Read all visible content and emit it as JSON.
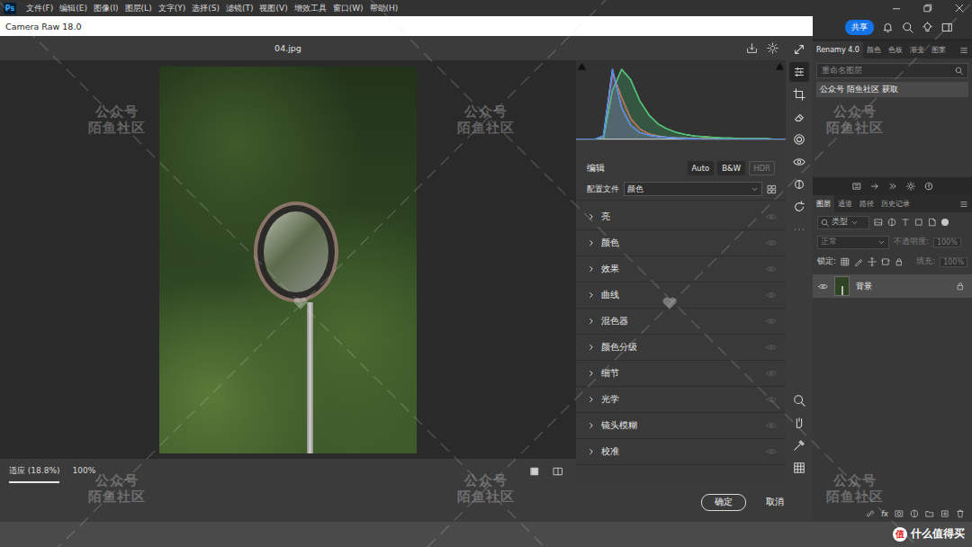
{
  "app": {
    "logo": "Ps",
    "menu": [
      "文件(F)",
      "编辑(E)",
      "图像(I)",
      "图层(L)",
      "文字(Y)",
      "选择(S)",
      "滤镜(T)",
      "视图(V)",
      "增效工具",
      "窗口(W)",
      "帮助(H)"
    ]
  },
  "toolbar": {
    "share": "共享"
  },
  "dialog": {
    "title": "Camera Raw 18.0",
    "file": "04.jpg",
    "histogram": {
      "series": [
        {
          "name": "red",
          "color": "#e0504a",
          "values": [
            0,
            0,
            0,
            2,
            95,
            60,
            30,
            15,
            8,
            5,
            3,
            2,
            2,
            1,
            1,
            1,
            0,
            0,
            0,
            0,
            0,
            0,
            0,
            0
          ]
        },
        {
          "name": "green",
          "color": "#3fc46a",
          "values": [
            0,
            0,
            0,
            1,
            70,
            100,
            85,
            55,
            35,
            22,
            15,
            10,
            7,
            5,
            4,
            3,
            2,
            2,
            1,
            1,
            1,
            1,
            0,
            0
          ]
        },
        {
          "name": "blue",
          "color": "#4a86e8",
          "values": [
            0,
            0,
            0,
            5,
            100,
            45,
            20,
            10,
            6,
            4,
            3,
            2,
            1,
            1,
            0,
            0,
            0,
            0,
            0,
            0,
            0,
            0,
            0,
            0
          ]
        }
      ]
    },
    "edit": {
      "label": "编辑",
      "buttons": [
        {
          "label": "Auto",
          "disabled": false
        },
        {
          "label": "B&W",
          "disabled": false
        },
        {
          "label": "HDR",
          "disabled": true
        }
      ]
    },
    "profile": {
      "label": "配置文件",
      "value": "颜色"
    },
    "sections": [
      {
        "label": "亮",
        "expanded": false
      },
      {
        "label": "颜色",
        "expanded": false
      },
      {
        "label": "效果",
        "expanded": false
      },
      {
        "label": "曲线",
        "expanded": false
      },
      {
        "label": "混色器",
        "expanded": false
      },
      {
        "label": "颜色分级",
        "expanded": false
      },
      {
        "label": "细节",
        "expanded": false
      },
      {
        "label": "光学",
        "expanded": false
      },
      {
        "label": "镜头模糊",
        "expanded": false
      },
      {
        "label": "校准",
        "expanded": false
      }
    ],
    "zoom": [
      {
        "label": "适应 (18.8%)",
        "selected": true
      },
      {
        "label": "100%",
        "selected": false
      }
    ],
    "ok": "确定",
    "cancel": "取消"
  },
  "plugin_panel": {
    "tabs": [
      {
        "label": "Renamy 4.0",
        "selected": true
      },
      {
        "label": "颜色",
        "selected": false
      },
      {
        "label": "色板",
        "selected": false
      },
      {
        "label": "渐变",
        "selected": false
      },
      {
        "label": "图案",
        "selected": false
      }
    ],
    "search_placeholder": "重命名图层",
    "items": [
      {
        "label": "公众号 陌鱼社区 获取",
        "selected": true
      }
    ]
  },
  "layers_panel": {
    "tabs": [
      {
        "label": "图层",
        "selected": true
      },
      {
        "label": "通道",
        "selected": false
      },
      {
        "label": "路径",
        "selected": false
      },
      {
        "label": "历史记录",
        "selected": false
      }
    ],
    "filter": "类型",
    "blend": {
      "value": "正常",
      "disabled": true
    },
    "opacity": {
      "label": "不透明度:",
      "value": "100%",
      "disabled": true
    },
    "lock_label": "锁定:",
    "fill": {
      "label": "填充:",
      "value": "100%",
      "disabled": true
    },
    "layers": [
      {
        "name": "背景",
        "visible": true,
        "locked": true,
        "selected": true
      }
    ],
    "fx_label": "fx"
  },
  "watermarks": [
    {
      "lines": [
        "公众号",
        "陌鱼社区"
      ]
    },
    {
      "lines": [
        "公众号",
        "陌鱼社区"
      ]
    },
    {
      "lines": [
        "公众号",
        "陌鱼社区"
      ]
    },
    {
      "lines": [
        "公众号",
        "陌鱼社区"
      ]
    },
    {
      "lines": [
        "公众号",
        "陌鱼社区"
      ]
    },
    {
      "lines": [
        "公众号",
        "陌鱼社区"
      ]
    }
  ],
  "brand": {
    "badge": "值",
    "name": "什么值得买"
  }
}
